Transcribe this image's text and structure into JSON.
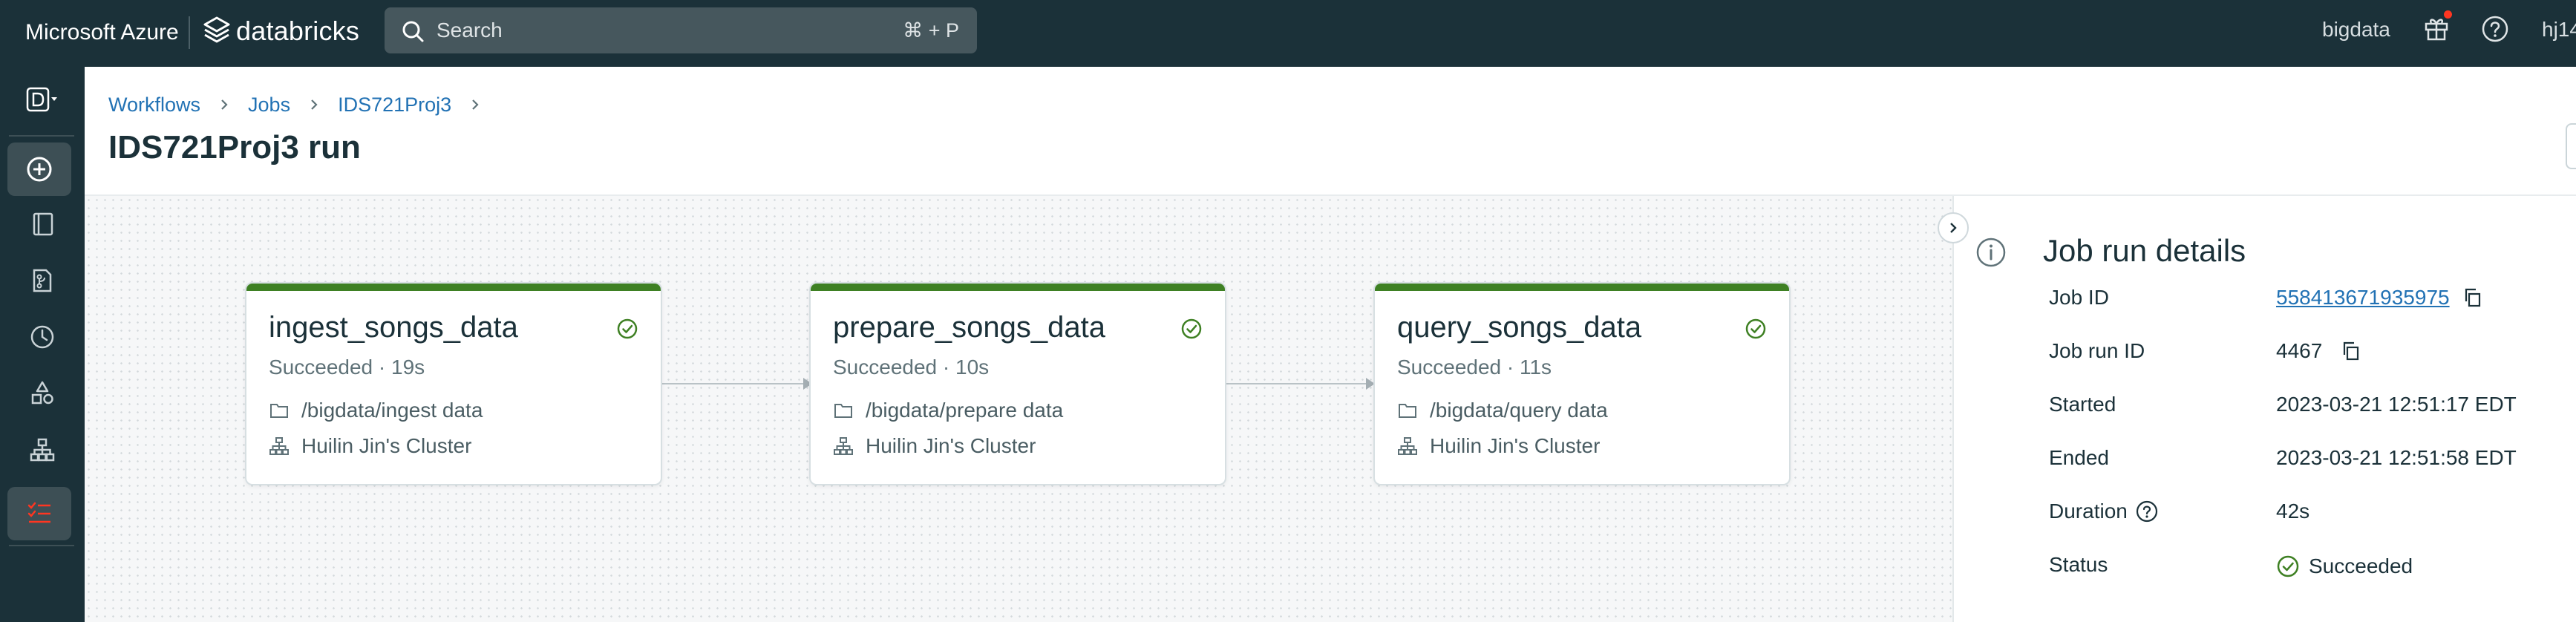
{
  "topbar": {
    "brand": "Microsoft Azure",
    "product": "databricks",
    "search_placeholder": "Search",
    "search_shortcut": "⌘ + P",
    "workspace": "bigdata",
    "user_initials": "hj14",
    "icons": [
      "databricks-logo-icon",
      "search-icon",
      "gift-icon",
      "help-icon"
    ],
    "notification_dot_color": "#ff3621"
  },
  "sidebar": {
    "items": [
      {
        "name": "workspace-switcher",
        "icon": "workspace-d-icon"
      },
      {
        "name": "new",
        "icon": "plus-circle-icon"
      },
      {
        "name": "workspace",
        "icon": "book-icon"
      },
      {
        "name": "repos",
        "icon": "branch-file-icon"
      },
      {
        "name": "recents",
        "icon": "clock-icon"
      },
      {
        "name": "data",
        "icon": "shapes-icon"
      },
      {
        "name": "compute",
        "icon": "cluster-icon"
      },
      {
        "name": "workflows",
        "icon": "workflows-icon",
        "active": true
      }
    ]
  },
  "header": {
    "breadcrumb": [
      "Workflows",
      "Jobs",
      "IDS721Proj3"
    ],
    "title": "IDS721Proj3 run"
  },
  "tasks": [
    {
      "name": "ingest_songs_data",
      "status": "Succeeded · 19s",
      "path": "/bigdata/ingest data",
      "cluster": "Huilin Jin's Cluster"
    },
    {
      "name": "prepare_songs_data",
      "status": "Succeeded · 10s",
      "path": "/bigdata/prepare data",
      "cluster": "Huilin Jin's Cluster"
    },
    {
      "name": "query_songs_data",
      "status": "Succeeded · 11s",
      "path": "/bigdata/query data",
      "cluster": "Huilin Jin's Cluster"
    }
  ],
  "details": {
    "title": "Job run details",
    "job_id_label": "Job ID",
    "job_id": "558413671935975",
    "job_run_id_label": "Job run ID",
    "job_run_id": "4467",
    "started_label": "Started",
    "started": "2023-03-21 12:51:17 EDT",
    "ended_label": "Ended",
    "ended": "2023-03-21 12:51:58 EDT",
    "duration_label": "Duration",
    "duration": "42s",
    "status_label": "Status",
    "status": "Succeeded"
  },
  "colors": {
    "topbar": "#1b3139",
    "success": "#3e8023",
    "link": "#2272b4",
    "accent": "#ff3621"
  }
}
